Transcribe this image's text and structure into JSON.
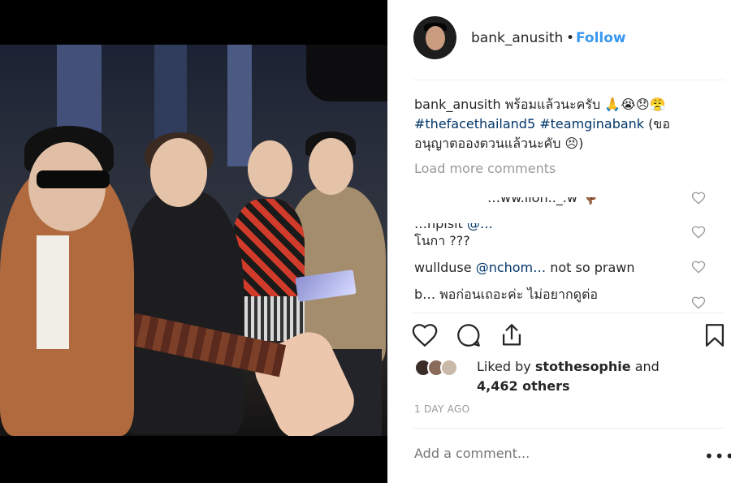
{
  "post": {
    "username": "bank_anusith",
    "follow_label": "Follow",
    "dot": "•",
    "caption_user": "bank_anusith",
    "caption_text": "พร้อมแล้วนะครับ 🙏😭😞😤",
    "caption_tags": [
      "#thefacethailand5",
      "#teamginabank"
    ],
    "caption_tail": "(ขอ อนุญาตอองตวนแล้วนะคับ 😣)",
    "load_more": "Load more comments"
  },
  "comments": [
    {
      "text": "…ww.iion.._.w 👎🏾"
    },
    {
      "user": "…hpisit",
      "mention": "@…",
      "text": "โนกา ???"
    },
    {
      "user": "wullduse",
      "mention": "@nchom…",
      "text": " not so prawn"
    },
    {
      "user": "b…",
      "text": " พอก่อนเถอะค่ะ ไม่อยากดูต่อ"
    }
  ],
  "likes": {
    "liked_by_prefix": "Liked by ",
    "liked_by_user": "stothesophie",
    "and": " and",
    "others": "4,462 others"
  },
  "timestamp": "1 DAY AGO",
  "add_comment_placeholder": "Add a comment...",
  "more_label": "•••",
  "colors": {
    "follow": "#3897f0",
    "hashtag": "#003569",
    "muted": "#999999"
  },
  "icons": [
    "heart-icon",
    "comment-icon",
    "share-icon",
    "bookmark-icon",
    "user-tag-icon",
    "more-options-icon"
  ]
}
